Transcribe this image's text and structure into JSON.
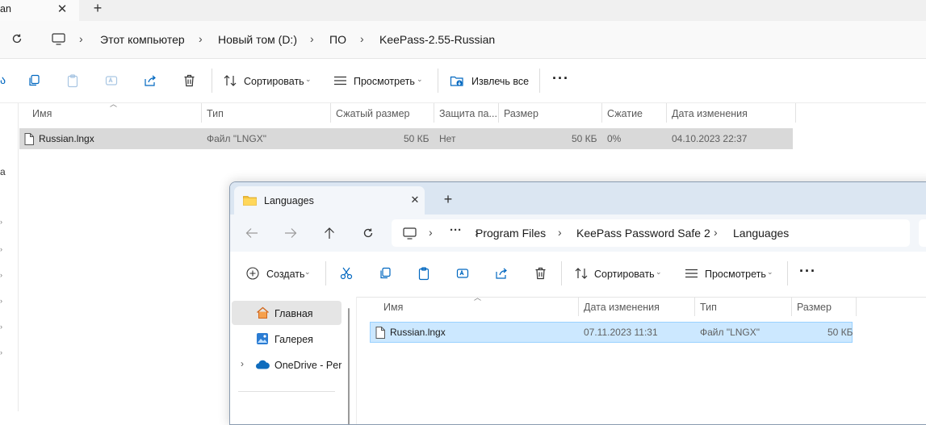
{
  "back": {
    "tab_fragment": "an",
    "breadcrumb": [
      "Этот компьютер",
      "Новый том (D:)",
      "ПО",
      "KeePass-2.55-Russian"
    ],
    "toolbar": {
      "sort": "Сортировать",
      "view": "Просмотреть",
      "extract_all": "Извлечь все"
    },
    "columns": [
      "Имя",
      "Тип",
      "Сжатый размер",
      "Защита па...",
      "Размер",
      "Сжатие",
      "Дата изменения"
    ],
    "row": {
      "name": "Russian.lngx",
      "type": "Файл \"LNGX\"",
      "compressed": "50 КБ",
      "protected": "Нет",
      "size": "50 КБ",
      "ratio": "0%",
      "modified": "04.10.2023 22:37"
    },
    "side_fragment": "a"
  },
  "front": {
    "tab_title": "Languages",
    "breadcrumb": [
      "Program Files",
      "KeePass Password Safe 2",
      "Languages"
    ],
    "toolbar": {
      "create": "Создать",
      "sort": "Сортировать",
      "view": "Просмотреть"
    },
    "sidebar": [
      {
        "label": "Главная"
      },
      {
        "label": "Галерея"
      },
      {
        "label": "OneDrive - Pers"
      }
    ],
    "columns": [
      "Имя",
      "Дата изменения",
      "Тип",
      "Размер"
    ],
    "row": {
      "name": "Russian.lngx",
      "modified": "07.11.2023 11:31",
      "type": "Файл \"LNGX\"",
      "size": "50 КБ"
    }
  },
  "colors": {
    "selection": "#cce8ff",
    "selection_border": "#99d1ff",
    "row_hover": "#d9d9d9",
    "accent": "#0067c0"
  }
}
